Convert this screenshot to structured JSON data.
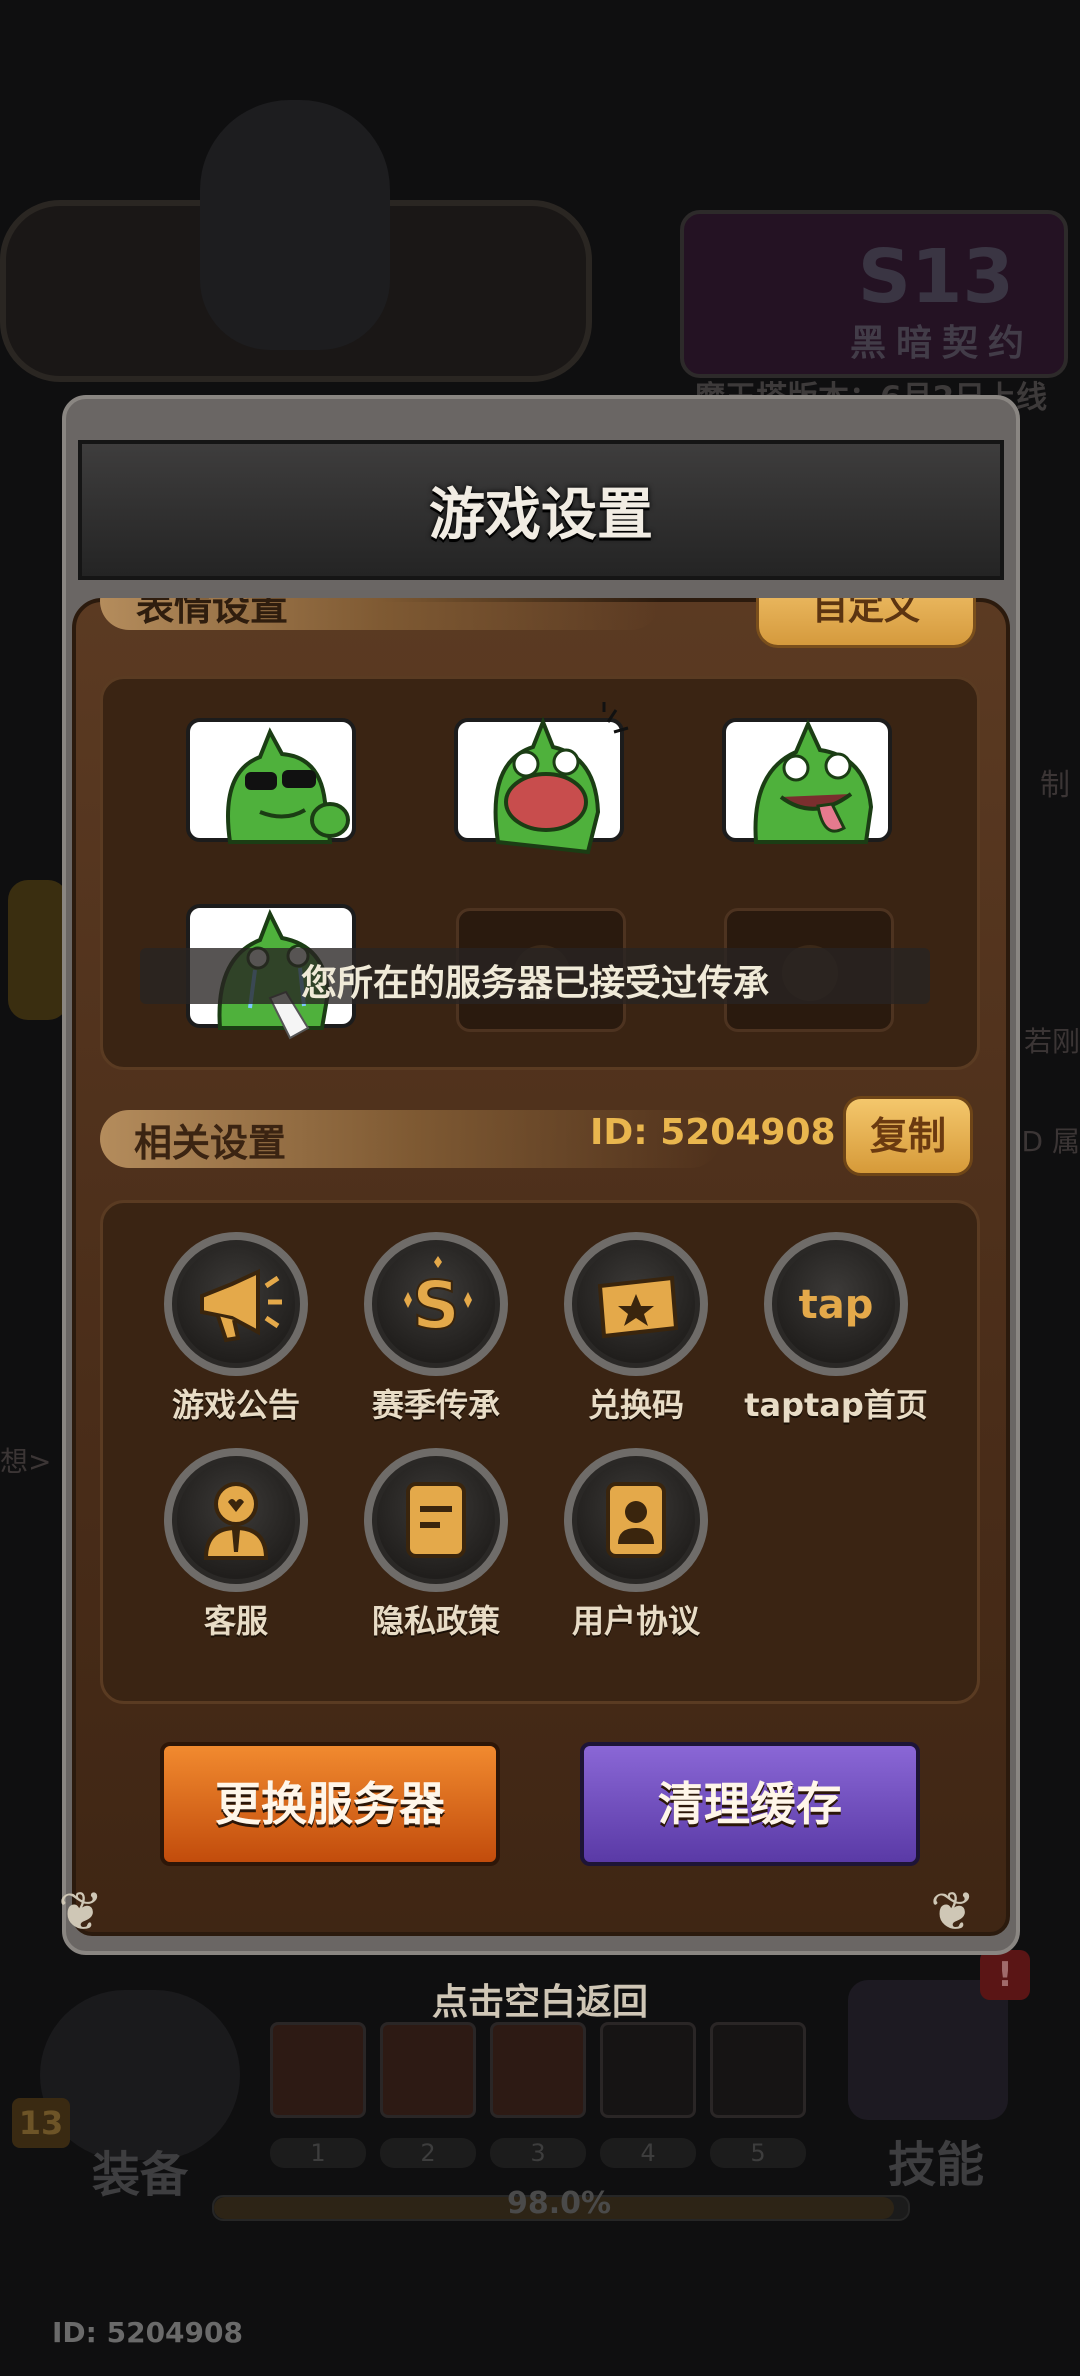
{
  "background": {
    "season_badge": "S13",
    "season_name": "黑暗契约",
    "version_notice": "魔王塔版本：6月2日上线",
    "side_right_1": "制",
    "side_right_2": "若刚",
    "side_right_3": "D 属",
    "side_left_1": "想>",
    "level": "13",
    "equip_label": "装备",
    "skill_label": "技能",
    "alert": "!",
    "slot_numbers": [
      "1",
      "2",
      "3",
      "4",
      "5"
    ],
    "progress_text": "98.0%",
    "progress_value": 0.98,
    "bottom_id": "ID: 5204908"
  },
  "dialog": {
    "title": "游戏设置",
    "emote_section": {
      "label": "表情设置",
      "custom_button": "自定义"
    },
    "emotes": [
      {
        "name": "cool-sunglasses",
        "locked": false
      },
      {
        "name": "screaming",
        "locked": false
      },
      {
        "name": "tongue-out",
        "locked": false
      },
      {
        "name": "crying-tissue",
        "locked": false
      },
      {
        "name": "locked-emote",
        "locked": true
      },
      {
        "name": "locked-emote",
        "locked": true
      }
    ],
    "toast": "您所在的服务器已接受过传承",
    "related_section": {
      "label": "相关设置",
      "id_text": "ID: 5204908",
      "copy_button": "复制"
    },
    "settings": [
      {
        "label": "游戏公告",
        "icon": "megaphone-icon"
      },
      {
        "label": "赛季传承",
        "icon": "season-s-icon"
      },
      {
        "label": "兑换码",
        "icon": "ticket-icon"
      },
      {
        "label": "taptap首页",
        "icon": "taptap-icon"
      },
      {
        "label": "客服",
        "icon": "customer-service-icon"
      },
      {
        "label": "隐私政策",
        "icon": "document-icon"
      },
      {
        "label": "用户协议",
        "icon": "user-card-icon"
      }
    ],
    "change_server_button": "更换服务器",
    "clear_cache_button": "清理缓存",
    "tap_blank_return": "点击空白返回"
  },
  "colors": {
    "accent_gold": "#e9b64e",
    "orange_button": "#d9631a",
    "purple_button": "#6f4fbf",
    "panel_brown": "#3a2413"
  }
}
